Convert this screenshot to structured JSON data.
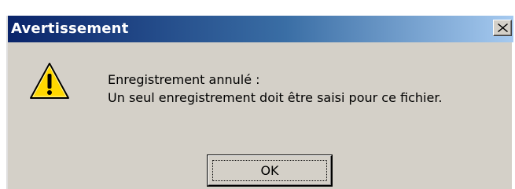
{
  "window": {
    "title": "Avertissement",
    "close_icon": "close-icon"
  },
  "message": {
    "icon": "warning-icon",
    "line1": "Enregistrement annulé :",
    "line2": "Un seul enregistrement doit être saisi pour ce fichier."
  },
  "buttons": {
    "ok_label": "OK"
  },
  "colors": {
    "titlebar_start": "#0a246a",
    "titlebar_end": "#a6caf0",
    "dialog_face": "#d4d0c8",
    "warning_yellow": "#ffd800"
  }
}
